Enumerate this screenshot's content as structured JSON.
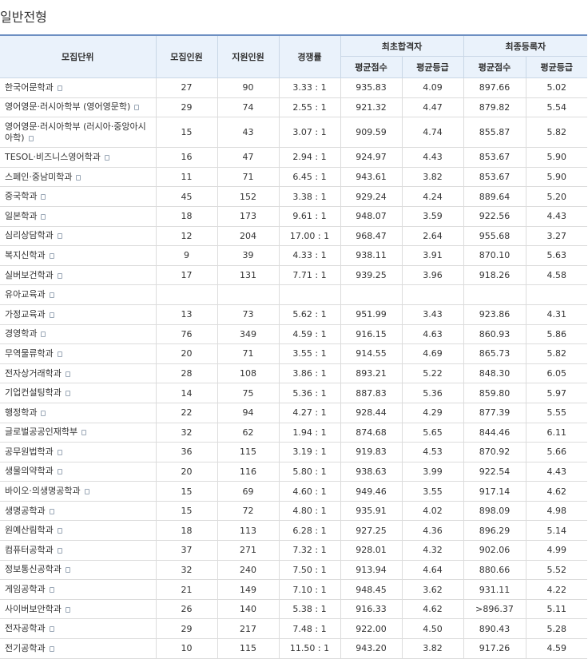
{
  "title": "일반전형",
  "headers": {
    "unit": "모집단위",
    "quota": "모집인원",
    "applicants": "지원인원",
    "ratio": "경쟁률",
    "first_group": "최초합격자",
    "final_group": "최종등록자",
    "avg_score": "평균점수",
    "avg_grade": "평균등급"
  },
  "rows": [
    {
      "unit": "한국어문학과",
      "quota": "27",
      "applicants": "90",
      "ratio": "3.33 : 1",
      "first_score": "935.83",
      "first_grade": "4.09",
      "final_score": "897.66",
      "final_grade": "5.02"
    },
    {
      "unit": "영어영문·러시아학부 (영어영문학)",
      "quota": "29",
      "applicants": "74",
      "ratio": "2.55 : 1",
      "first_score": "921.32",
      "first_grade": "4.47",
      "final_score": "879.82",
      "final_grade": "5.54"
    },
    {
      "unit": "영어영문·러시아학부 (러시아·중앙아시아학)",
      "quota": "15",
      "applicants": "43",
      "ratio": "3.07 : 1",
      "first_score": "909.59",
      "first_grade": "4.74",
      "final_score": "855.87",
      "final_grade": "5.82"
    },
    {
      "unit": "TESOL·비즈니스영어학과",
      "quota": "16",
      "applicants": "47",
      "ratio": "2.94 : 1",
      "first_score": "924.97",
      "first_grade": "4.43",
      "final_score": "853.67",
      "final_grade": "5.90"
    },
    {
      "unit": "스페인·중남미학과",
      "quota": "11",
      "applicants": "71",
      "ratio": "6.45 : 1",
      "first_score": "943.61",
      "first_grade": "3.82",
      "final_score": "853.67",
      "final_grade": "5.90"
    },
    {
      "unit": "중국학과",
      "quota": "45",
      "applicants": "152",
      "ratio": "3.38 : 1",
      "first_score": "929.24",
      "first_grade": "4.24",
      "final_score": "889.64",
      "final_grade": "5.20"
    },
    {
      "unit": "일본학과",
      "quota": "18",
      "applicants": "173",
      "ratio": "9.61 : 1",
      "first_score": "948.07",
      "first_grade": "3.59",
      "final_score": "922.56",
      "final_grade": "4.43"
    },
    {
      "unit": "심리상담학과",
      "quota": "12",
      "applicants": "204",
      "ratio": "17.00 : 1",
      "first_score": "968.47",
      "first_grade": "2.64",
      "final_score": "955.68",
      "final_grade": "3.27"
    },
    {
      "unit": "복지신학과",
      "quota": "9",
      "applicants": "39",
      "ratio": "4.33 : 1",
      "first_score": "938.11",
      "first_grade": "3.91",
      "final_score": "870.10",
      "final_grade": "5.63"
    },
    {
      "unit": "실버보건학과",
      "quota": "17",
      "applicants": "131",
      "ratio": "7.71 : 1",
      "first_score": "939.25",
      "first_grade": "3.96",
      "final_score": "918.26",
      "final_grade": "4.58"
    },
    {
      "unit": "유아교육과",
      "quota": "",
      "applicants": "",
      "ratio": "",
      "first_score": "",
      "first_grade": "",
      "final_score": "",
      "final_grade": ""
    },
    {
      "unit": "가정교육과",
      "quota": "13",
      "applicants": "73",
      "ratio": "5.62 : 1",
      "first_score": "951.99",
      "first_grade": "3.43",
      "final_score": "923.86",
      "final_grade": "4.31"
    },
    {
      "unit": "경영학과",
      "quota": "76",
      "applicants": "349",
      "ratio": "4.59 : 1",
      "first_score": "916.15",
      "first_grade": "4.63",
      "final_score": "860.93",
      "final_grade": "5.86"
    },
    {
      "unit": "무역물류학과",
      "quota": "20",
      "applicants": "71",
      "ratio": "3.55 : 1",
      "first_score": "914.55",
      "first_grade": "4.69",
      "final_score": "865.73",
      "final_grade": "5.82"
    },
    {
      "unit": "전자상거래학과",
      "quota": "28",
      "applicants": "108",
      "ratio": "3.86 : 1",
      "first_score": "893.21",
      "first_grade": "5.22",
      "final_score": "848.30",
      "final_grade": "6.05"
    },
    {
      "unit": "기업컨설팅학과",
      "quota": "14",
      "applicants": "75",
      "ratio": "5.36 : 1",
      "first_score": "887.83",
      "first_grade": "5.36",
      "final_score": "859.80",
      "final_grade": "5.97"
    },
    {
      "unit": "행정학과",
      "quota": "22",
      "applicants": "94",
      "ratio": "4.27 : 1",
      "first_score": "928.44",
      "first_grade": "4.29",
      "final_score": "877.39",
      "final_grade": "5.55"
    },
    {
      "unit": "글로벌공공인재학부",
      "quota": "32",
      "applicants": "62",
      "ratio": "1.94 : 1",
      "first_score": "874.68",
      "first_grade": "5.65",
      "final_score": "844.46",
      "final_grade": "6.11"
    },
    {
      "unit": "공무원법학과",
      "quota": "36",
      "applicants": "115",
      "ratio": "3.19 : 1",
      "first_score": "919.83",
      "first_grade": "4.53",
      "final_score": "870.92",
      "final_grade": "5.66"
    },
    {
      "unit": "생물의약학과",
      "quota": "20",
      "applicants": "116",
      "ratio": "5.80 : 1",
      "first_score": "938.63",
      "first_grade": "3.99",
      "final_score": "922.54",
      "final_grade": "4.43"
    },
    {
      "unit": "바이오·의생명공학과",
      "quota": "15",
      "applicants": "69",
      "ratio": "4.60 : 1",
      "first_score": "949.46",
      "first_grade": "3.55",
      "final_score": "917.14",
      "final_grade": "4.62"
    },
    {
      "unit": "생명공학과",
      "quota": "15",
      "applicants": "72",
      "ratio": "4.80 : 1",
      "first_score": "935.91",
      "first_grade": "4.02",
      "final_score": "898.09",
      "final_grade": "4.98"
    },
    {
      "unit": "원예산림학과",
      "quota": "18",
      "applicants": "113",
      "ratio": "6.28 : 1",
      "first_score": "927.25",
      "first_grade": "4.36",
      "final_score": "896.29",
      "final_grade": "5.14"
    },
    {
      "unit": "컴퓨터공학과",
      "quota": "37",
      "applicants": "271",
      "ratio": "7.32 : 1",
      "first_score": "928.01",
      "first_grade": "4.32",
      "final_score": "902.06",
      "final_grade": "4.99"
    },
    {
      "unit": "정보통신공학과",
      "quota": "32",
      "applicants": "240",
      "ratio": "7.50 : 1",
      "first_score": "913.94",
      "first_grade": "4.64",
      "final_score": "880.66",
      "final_grade": "5.52"
    },
    {
      "unit": "게임공학과",
      "quota": "21",
      "applicants": "149",
      "ratio": "7.10 : 1",
      "first_score": "948.45",
      "first_grade": "3.62",
      "final_score": "931.11",
      "final_grade": "4.22"
    },
    {
      "unit": "사이버보안학과",
      "quota": "26",
      "applicants": "140",
      "ratio": "5.38 : 1",
      "first_score": "916.33",
      "first_grade": "4.62",
      "final_score": ">896.37",
      "final_grade": "5.11"
    },
    {
      "unit": "전자공학과",
      "quota": "29",
      "applicants": "217",
      "ratio": "7.48 : 1",
      "first_score": "922.00",
      "first_grade": "4.50",
      "final_score": "890.43",
      "final_grade": "5.28"
    },
    {
      "unit": "전기공학과",
      "quota": "10",
      "applicants": "115",
      "ratio": "11.50 : 1",
      "first_score": "943.20",
      "first_grade": "3.82",
      "final_score": "917.26",
      "final_grade": "4.59"
    }
  ]
}
